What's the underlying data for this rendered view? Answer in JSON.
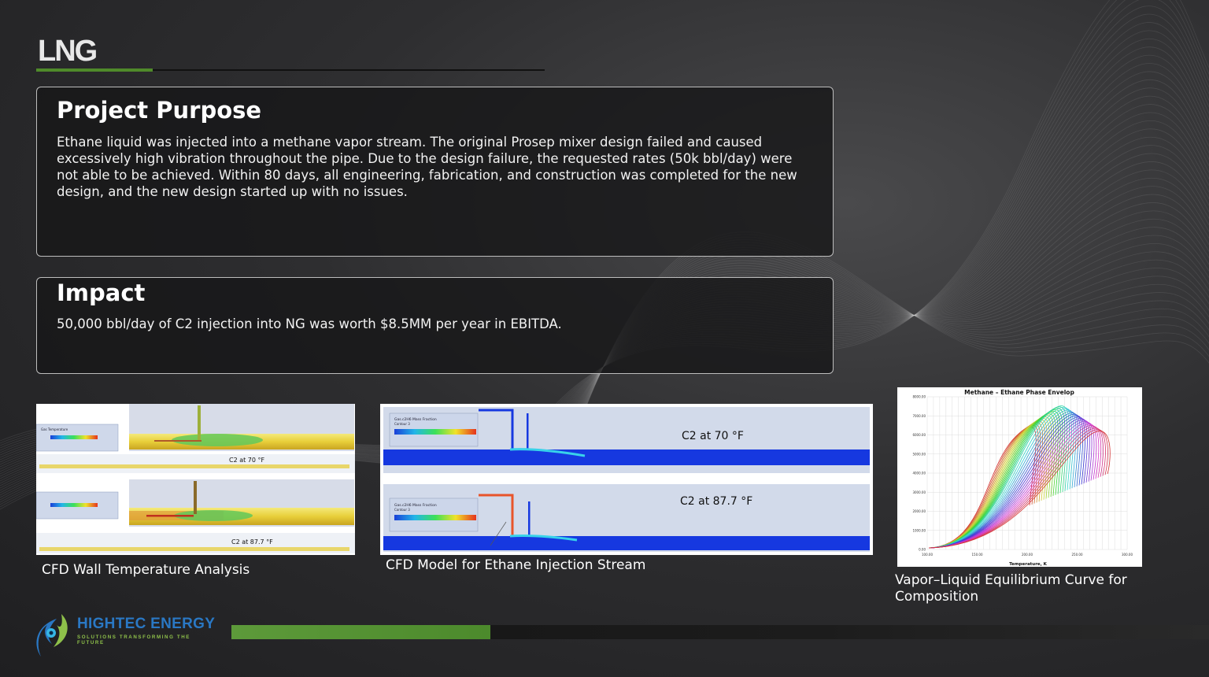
{
  "slide": {
    "title": "LNG"
  },
  "purpose": {
    "heading": "Project Purpose",
    "body": "Ethane liquid was injected into a methane vapor stream. The original Prosep mixer design failed and caused excessively high vibration throughout the pipe. Due to the design failure, the requested rates (50k bbl/day) were not able to be achieved. Within 80 days, all engineering, fabrication, and construction was completed for the new design, and the new design started up with no issues."
  },
  "impact": {
    "heading": "Impact",
    "body": "50,000 bbl/day of C2 injection into NG was worth $8.5MM per year in EBITDA."
  },
  "figures": {
    "wall_temp": {
      "caption": "CFD Wall Temperature Analysis",
      "label_top": "C2 at 70 °F",
      "label_bottom": "C2 at 87.7 °F",
      "legend_title": "Gas Temperature"
    },
    "injection": {
      "caption": "CFD Model for Ethane Injection Stream",
      "label_top": "C2 at 70 °F",
      "label_bottom": "C2 at 87.7 °F",
      "legend_title": "Gas.c2H6 Mass Fraction",
      "legend_sub": "Contour 3"
    },
    "vle": {
      "caption": "Vapor–Liquid Equilibrium Curve for Composition",
      "chart_title": "Methane – Ethane Phase Envelop",
      "x_axis_label": "Temperature, K",
      "x_ticks": [
        "100.00",
        "150.00",
        "200.00",
        "250.00",
        "300.00"
      ],
      "y_ticks": [
        "0.00",
        "1000.00",
        "2000.00",
        "3000.00",
        "4000.00",
        "5000.00",
        "6000.00",
        "7000.00",
        "8000.00"
      ]
    }
  },
  "brand": {
    "name": "HIGHTEC ENERGY",
    "tagline": "SOLUTIONS TRANSFORMING THE FUTURE",
    "color_blue": "#2a78c4",
    "color_green": "#8ec04a"
  },
  "progress": {
    "fraction": 0.265
  }
}
